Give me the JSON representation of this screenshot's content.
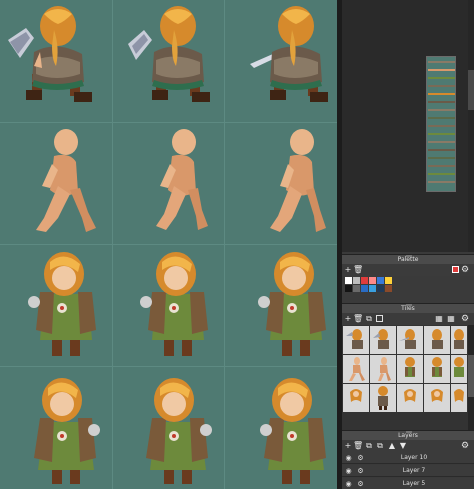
{
  "panels": {
    "palette": {
      "title": "Palette"
    },
    "tiles": {
      "title": "Tiles"
    },
    "layers": {
      "title": "Layers"
    }
  },
  "palette_colors": [
    "#ffffff",
    "#bdbdbd",
    "#e03c3c",
    "#ff8a8a",
    "#3a7ad8",
    "#ffd23a",
    "#141414",
    "#6a6a6a",
    "#2a6cc4",
    "#3aa0e0",
    "#1f3a5a",
    "#8a4a2a"
  ],
  "layers": [
    {
      "name": "Layer 10"
    },
    {
      "name": "Layer 7"
    },
    {
      "name": "Layer 5"
    }
  ],
  "colors": {
    "canvas_bg": "#4f7a72",
    "grid_line": "#5d8a82",
    "panel_bg": "#3a3a3a",
    "panel_header": "#4b4b4b",
    "accent_selection": "#e03c3c"
  },
  "icons": {
    "palette_toolbar": [
      "add-icon",
      "delete-icon",
      "gear-icon"
    ],
    "tiles_toolbar": [
      "add-icon",
      "delete-icon",
      "duplicate-icon",
      "box-icon",
      "tile-grid-icon",
      "tile-grid-icon",
      "gear-icon"
    ],
    "layers_toolbar": [
      "add-icon",
      "delete-icon",
      "duplicate-icon",
      "merge-icon",
      "arrow-up-icon",
      "arrow-down-icon",
      "gear-icon"
    ],
    "layer_row": [
      "eye-icon",
      "lock-icon"
    ]
  }
}
